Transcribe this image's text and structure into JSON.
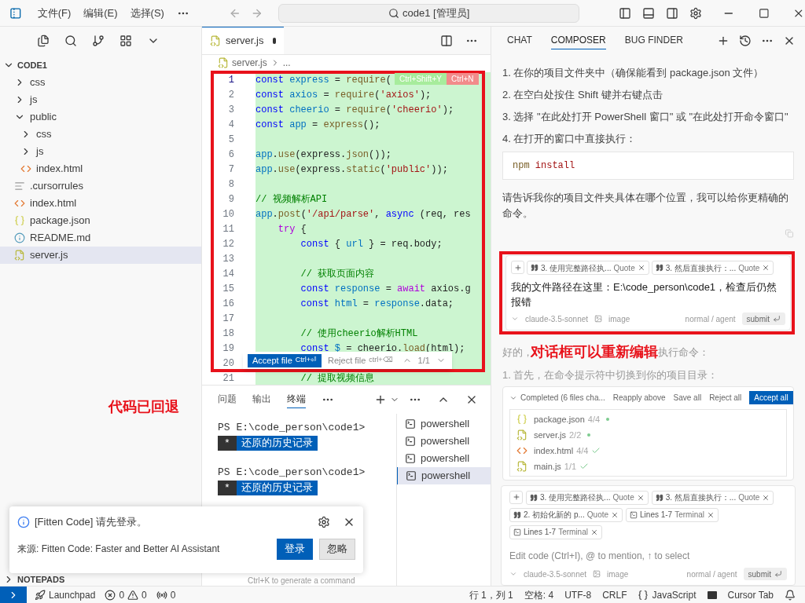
{
  "titlebar": {
    "menus": [
      "文件(F)",
      "编辑(E)",
      "选择(S)"
    ],
    "search": "code1 [管理员]"
  },
  "explorer": {
    "root": "CODE1",
    "expanded": true,
    "items": [
      {
        "name": "css",
        "kind": "folder",
        "expanded": false,
        "selected": false
      },
      {
        "name": "js",
        "kind": "folder",
        "expanded": false,
        "selected": false
      },
      {
        "name": "public",
        "kind": "folder",
        "expanded": true,
        "selected": false,
        "children": [
          {
            "name": "css",
            "kind": "folder",
            "expanded": false,
            "selected": false
          },
          {
            "name": "js",
            "kind": "folder",
            "expanded": false,
            "selected": false
          },
          {
            "name": "index.html",
            "kind": "html",
            "selected": false
          }
        ]
      },
      {
        "name": ".cursorrules",
        "kind": "text",
        "selected": false
      },
      {
        "name": "index.html",
        "kind": "html",
        "selected": false
      },
      {
        "name": "package.json",
        "kind": "json",
        "selected": false
      },
      {
        "name": "README.md",
        "kind": "info",
        "selected": false
      },
      {
        "name": "server.js",
        "kind": "js",
        "selected": true
      }
    ],
    "sections": [
      {
        "title": "NOTEPADS"
      }
    ]
  },
  "annotations": [
    "代码已回退",
    "对话框可以重新编辑"
  ],
  "editor": {
    "tab": {
      "label": "server.js",
      "modified": true
    },
    "breadcrumb": [
      "server.js",
      "..."
    ],
    "badges": [
      "Ctrl+Shift+Y",
      "Ctrl+N"
    ],
    "lines": [
      {
        "number": "1",
        "tokens": [
          {
            "kind": "keyword",
            "text": "const "
          },
          {
            "kind": "const",
            "text": "express"
          },
          {
            "kind": "plain",
            "text": " = "
          },
          {
            "kind": "function",
            "text": "require"
          },
          {
            "kind": "plain",
            "text": "("
          }
        ]
      },
      {
        "number": "2",
        "tokens": [
          {
            "kind": "keyword",
            "text": "const "
          },
          {
            "kind": "const",
            "text": "axios"
          },
          {
            "kind": "plain",
            "text": " = "
          },
          {
            "kind": "function",
            "text": "require"
          },
          {
            "kind": "plain",
            "text": "("
          },
          {
            "kind": "string",
            "text": "'axios'"
          },
          {
            "kind": "plain",
            "text": ");"
          }
        ]
      },
      {
        "number": "3",
        "tokens": [
          {
            "kind": "keyword",
            "text": "const "
          },
          {
            "kind": "const",
            "text": "cheerio"
          },
          {
            "kind": "plain",
            "text": " = "
          },
          {
            "kind": "function",
            "text": "require"
          },
          {
            "kind": "plain",
            "text": "("
          },
          {
            "kind": "string",
            "text": "'cheerio'"
          },
          {
            "kind": "plain",
            "text": ");"
          }
        ]
      },
      {
        "number": "4",
        "tokens": [
          {
            "kind": "keyword",
            "text": "const "
          },
          {
            "kind": "const",
            "text": "app"
          },
          {
            "kind": "plain",
            "text": " = "
          },
          {
            "kind": "function",
            "text": "express"
          },
          {
            "kind": "plain",
            "text": "();"
          }
        ]
      },
      {
        "number": "5"
      },
      {
        "number": "6",
        "tokens": [
          {
            "kind": "const",
            "text": "app"
          },
          {
            "kind": "plain",
            "text": "."
          },
          {
            "kind": "function",
            "text": "use"
          },
          {
            "kind": "plain",
            "text": "(express."
          },
          {
            "kind": "function",
            "text": "json"
          },
          {
            "kind": "plain",
            "text": "());"
          }
        ]
      },
      {
        "number": "7",
        "tokens": [
          {
            "kind": "const",
            "text": "app"
          },
          {
            "kind": "plain",
            "text": "."
          },
          {
            "kind": "function",
            "text": "use"
          },
          {
            "kind": "plain",
            "text": "(express."
          },
          {
            "kind": "function",
            "text": "static"
          },
          {
            "kind": "plain",
            "text": "("
          },
          {
            "kind": "string",
            "text": "'public'"
          },
          {
            "kind": "plain",
            "text": "));"
          }
        ]
      },
      {
        "number": "8"
      },
      {
        "number": "9",
        "tokens": [
          {
            "kind": "comment",
            "text": "// 视频解析API"
          }
        ]
      },
      {
        "number": "10",
        "tokens": [
          {
            "kind": "const",
            "text": "app"
          },
          {
            "kind": "plain",
            "text": "."
          },
          {
            "kind": "function",
            "text": "post"
          },
          {
            "kind": "plain",
            "text": "("
          },
          {
            "kind": "string",
            "text": "'/api/parse'"
          },
          {
            "kind": "plain",
            "text": ", "
          },
          {
            "kind": "keyword",
            "text": "async"
          },
          {
            "kind": "plain",
            "text": " (req, res"
          }
        ]
      },
      {
        "number": "11",
        "tokens": [
          {
            "kind": "control",
            "text": "    try"
          },
          {
            "kind": "plain",
            "text": " {"
          }
        ]
      },
      {
        "number": "12",
        "tokens": [
          {
            "kind": "keyword",
            "text": "        const "
          },
          {
            "kind": "plain",
            "text": "{ "
          },
          {
            "kind": "const",
            "text": "url"
          },
          {
            "kind": "plain",
            "text": " } = req.body;"
          }
        ]
      },
      {
        "number": "13"
      },
      {
        "number": "14",
        "tokens": [
          {
            "kind": "comment",
            "text": "        // 获取页面内容"
          }
        ]
      },
      {
        "number": "15",
        "tokens": [
          {
            "kind": "keyword",
            "text": "        const "
          },
          {
            "kind": "const",
            "text": "response"
          },
          {
            "kind": "plain",
            "text": " = "
          },
          {
            "kind": "control",
            "text": "await"
          },
          {
            "kind": "plain",
            "text": " axios.g"
          }
        ]
      },
      {
        "number": "16",
        "tokens": [
          {
            "kind": "keyword",
            "text": "        const "
          },
          {
            "kind": "const",
            "text": "html"
          },
          {
            "kind": "plain",
            "text": " = "
          },
          {
            "kind": "const",
            "text": "response"
          },
          {
            "kind": "plain",
            "text": ".data;"
          }
        ]
      },
      {
        "number": "17"
      },
      {
        "number": "18",
        "tokens": [
          {
            "kind": "comment",
            "text": "        // 使用cheerio解析HTML"
          }
        ]
      },
      {
        "number": "19",
        "tokens": [
          {
            "kind": "keyword",
            "text": "        const "
          },
          {
            "kind": "const",
            "text": "$"
          },
          {
            "kind": "plain",
            "text": " = cheerio."
          },
          {
            "kind": "function",
            "text": "load"
          },
          {
            "kind": "plain",
            "text": "(html);"
          }
        ]
      },
      {
        "number": "20"
      },
      {
        "number": "21",
        "tokens": [
          {
            "kind": "comment",
            "text": "        // 提取视频信息"
          }
        ]
      }
    ],
    "review": {
      "accept": "Accept file",
      "accept_key": "Ctrl+⏎",
      "reject": "Reject file",
      "reject_key": "ctrl+⌫",
      "counter": "1/1"
    }
  },
  "panel": {
    "tabs": [
      {
        "label": "问题",
        "selected": false
      },
      {
        "label": "输出",
        "selected": false
      },
      {
        "label": "终端",
        "selected": true
      }
    ],
    "terminal": [
      {
        "prompt": "PS E:\\code_person\\code1>",
        "mark": "*",
        "history": "还原的历史记录"
      },
      {
        "prompt": "PS E:\\code_person\\code1>",
        "mark": "*",
        "history": "还原的历史记录"
      }
    ],
    "hint": "Ctrl+K to generate a command",
    "terminals": [
      {
        "label": "powershell",
        "selected": false
      },
      {
        "label": "powershell",
        "selected": false
      },
      {
        "label": "powershell",
        "selected": false
      },
      {
        "label": "powershell",
        "selected": true
      }
    ]
  },
  "assistant": {
    "tabs": [
      {
        "label": "CHAT",
        "selected": false
      },
      {
        "label": "COMPOSER",
        "selected": true
      },
      {
        "label": "BUG FINDER",
        "selected": false
      }
    ],
    "steps": [
      "1. 在你的项目文件夹中（确保能看到 package.json 文件）",
      "2. 在空白处按住 Shift 键并右键点击",
      "3. 选择 \"在此处打开 PowerShell 窗口\" 或 \"在此处打开命令窗口\"",
      "4. 在打开的窗口中直接执行："
    ],
    "code": [
      {
        "kind": "plain",
        "text": "npm "
      },
      {
        "kind": "string",
        "text": "install"
      }
    ],
    "paragraph": "请告诉我你的项目文件夹具体在哪个位置，我可以给你更精确的命令。",
    "edit_box": {
      "chips": [
        {
          "kind": "quote",
          "label": "3. 使用完整路径执...",
          "tag": "Quote"
        },
        {
          "kind": "quote",
          "label": "3. 然后直接执行：...",
          "tag": "Quote"
        }
      ],
      "text": "我的文件路径在这里：E:\\code_person\\code1，检查后仍然报错",
      "model": "claude-3.5-sonnet",
      "image": "image",
      "mode": "normal / agent",
      "submit": "submit"
    },
    "reply": {
      "start": "好的，",
      "end": "执行命令：",
      "step": "1. 首先，在命令提示符中切换到你的项目目录："
    },
    "changes": {
      "title": "Completed (6 files cha...",
      "actions": [
        "Reapply above",
        "Save all",
        "Reject all"
      ],
      "accept": "Accept all",
      "files": [
        {
          "name": "package.json",
          "kind": "json",
          "count": "4/4",
          "accepted": false
        },
        {
          "name": "server.js",
          "kind": "js",
          "count": "2/2",
          "accepted": false
        },
        {
          "name": "index.html",
          "kind": "html",
          "count": "4/4",
          "accepted": true
        },
        {
          "name": "main.js",
          "kind": "js",
          "count": "1/1",
          "accepted": true
        }
      ]
    },
    "input": {
      "chips": [
        {
          "kind": "quote",
          "label": "3. 使用完整路径执...",
          "tag": "Quote"
        },
        {
          "kind": "quote",
          "label": "3. 然后直接执行：...",
          "tag": "Quote"
        },
        {
          "kind": "quote",
          "label": "2. 初始化新的 p...",
          "tag": "Quote"
        },
        {
          "kind": "terminal",
          "label": "Lines 1-7",
          "tag": "Terminal"
        },
        {
          "kind": "terminal",
          "label": "Lines 1-7",
          "tag": "Terminal"
        }
      ],
      "placeholder": "Edit code (Ctrl+I), @ to mention, ↑ to select",
      "model": "claude-3.5-sonnet",
      "image": "image",
      "mode": "normal / agent",
      "submit": "submit"
    }
  },
  "notification": {
    "title": "[Fitten Code] 请先登录。",
    "source": "来源: Fitten Code: Faster and Better AI Assistant",
    "buttons": [
      {
        "label": "登录",
        "primary": true
      },
      {
        "label": "忽略",
        "primary": false
      }
    ]
  },
  "status_bar": {
    "launchpad": "Launchpad",
    "errors": "0",
    "warnings": "0",
    "ports": "0",
    "right": [
      "行 1，列 1",
      "空格: 4",
      "UTF-8",
      "CRLF"
    ],
    "language": "JavaScript",
    "tab": "Cursor Tab"
  }
}
